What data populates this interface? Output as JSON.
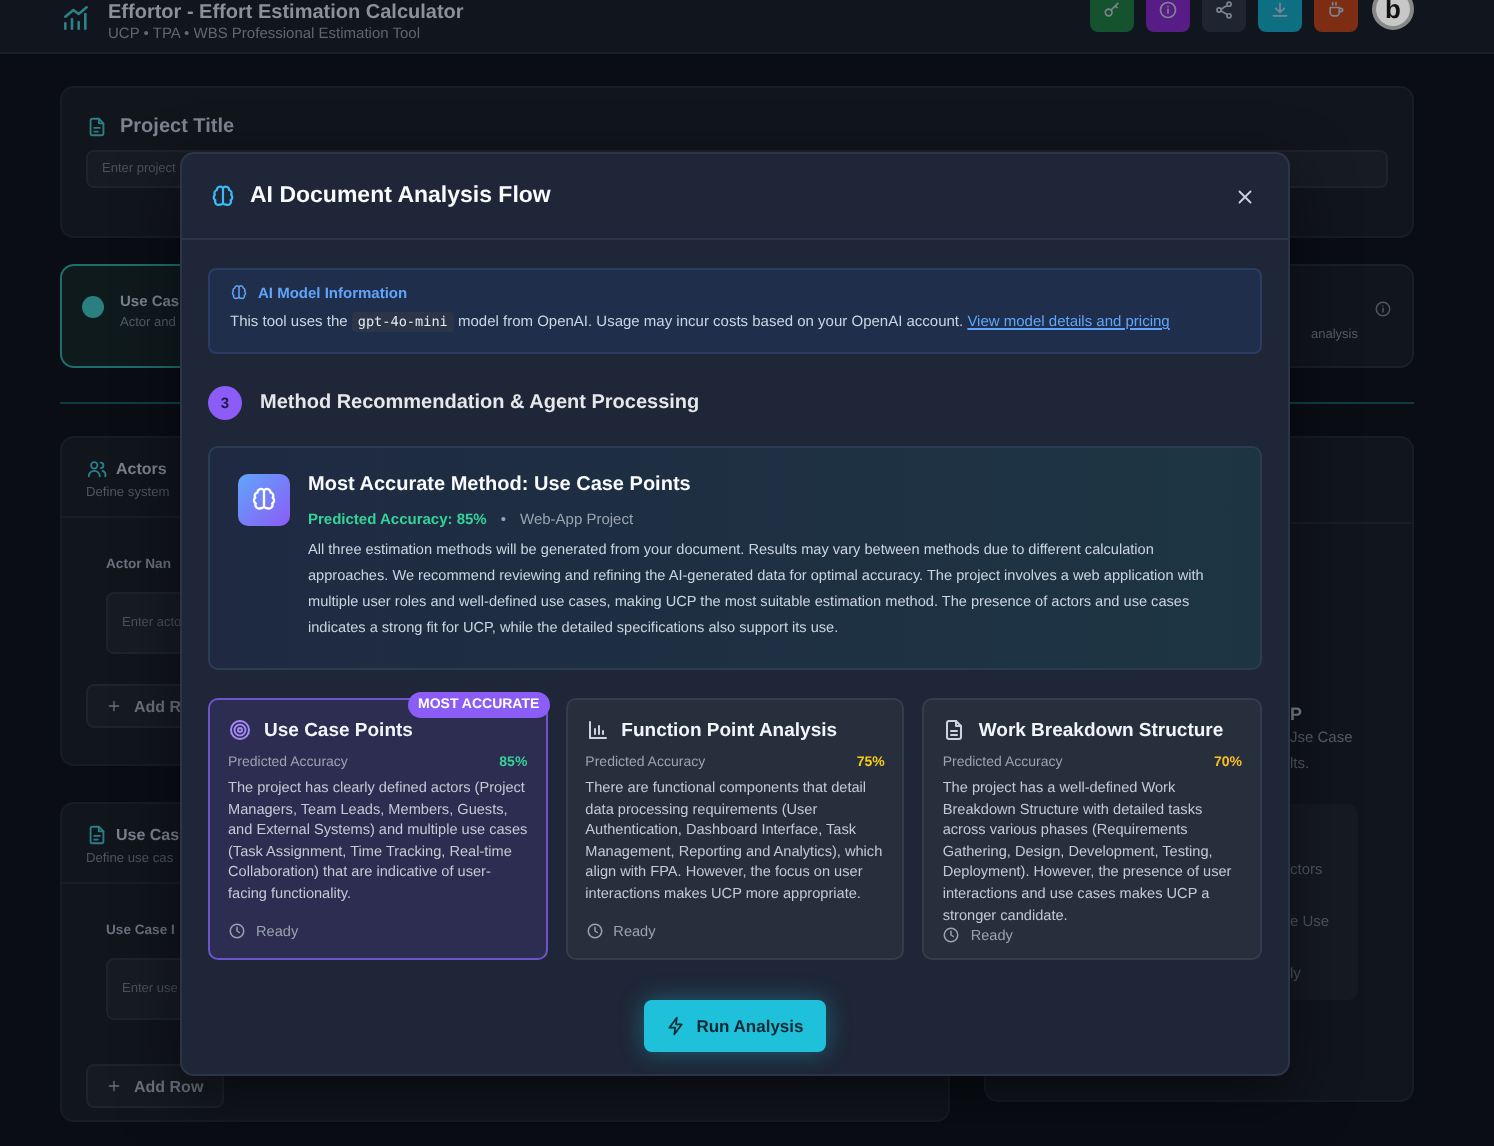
{
  "header": {
    "title": "Effortor - Effort Estimation Calculator",
    "subtitle": "UCP • TPA • WBS Professional Estimation Tool",
    "actions": [
      {
        "kind": "key",
        "color": "#14532d"
      },
      {
        "kind": "info",
        "color": "#581c87"
      },
      {
        "kind": "share",
        "color": "#1f2530"
      },
      {
        "kind": "download",
        "color": "#0e6f82"
      },
      {
        "kind": "coffee",
        "color": "#7c2d12"
      }
    ],
    "avatar": "b"
  },
  "project": {
    "title": "Project Title",
    "placeholder": "Enter project"
  },
  "options": [
    {
      "title": "Use Cas",
      "description": "Actor and",
      "selected": true
    },
    {
      "description": "analysis",
      "selected": false
    }
  ],
  "actors": {
    "title": "Actors",
    "description": "Define system",
    "column": "Actor Nan",
    "placeholder": "Enter acto",
    "add": "Add R"
  },
  "use_cases": {
    "title": "Use Cas",
    "description": "Define use cas",
    "column": "Use Case I",
    "placeholder": "Enter use",
    "add": "Add Row"
  },
  "results": {
    "title": "P",
    "lines": [
      "Jse Case",
      "lts."
    ],
    "notes": [
      "ctors",
      "e Use",
      "ly"
    ]
  },
  "modal": {
    "title": "AI Document Analysis Flow",
    "info": {
      "title": "AI Model Information",
      "text_before": "This tool uses the",
      "code": "gpt-4o-mini",
      "text_after": "model from OpenAI. Usage may incur costs based on your OpenAI account.",
      "link": "View model details and pricing"
    },
    "step": {
      "number": "3",
      "title": "Method Recommendation & Agent Processing"
    },
    "recommendation": {
      "title": "Most Accurate Method: Use Case Points",
      "accuracy": "Predicted Accuracy: 85%",
      "separator": "•",
      "project_type": "Web-App Project",
      "text": "All three estimation methods will be generated from your document. Results may vary between methods due to different calculation approaches. We recommend reviewing and refining the AI-generated data for optimal accuracy. The project involves a web application with multiple user roles and well-defined use cases, making UCP the most suitable estimation method. The presence of actors and use cases indicates a strong fit for UCP, while the detailed specifications also support its use."
    },
    "methods": [
      {
        "kind": "target",
        "title": "Use Case Points",
        "label": "Predicted Accuracy",
        "accuracy": "85%",
        "color": "#34d399",
        "description": "The project has clearly defined actors (Project Managers, Team Leads, Members, Guests, and External Systems) and multiple use cases (Task Assignment, Time Tracking, Real-time Collaboration) that are indicative of user-facing functionality.",
        "status": "Ready",
        "selected": true,
        "badge": "MOST ACCURATE"
      },
      {
        "kind": "chart",
        "title": "Function Point Analysis",
        "label": "Predicted Accuracy",
        "accuracy": "75%",
        "color": "#facc15",
        "description": "There are functional components that detail data processing requirements (User Authentication, Dashboard Interface, Task Management, Reporting and Analytics), which align with FPA. However, the focus on user interactions makes UCP more appropriate.",
        "status": "Ready",
        "selected": false
      },
      {
        "kind": "document",
        "title": "Work Breakdown Structure",
        "label": "Predicted Accuracy",
        "accuracy": "70%",
        "color": "#fbbf24",
        "description": "The project has a well-defined Work Breakdown Structure with detailed tasks across various phases (Requirements Gathering, Design, Development, Testing, Deployment). However, the presence of user interactions and use cases makes UCP a stronger candidate.",
        "status": "Ready",
        "selected": false
      }
    ],
    "run_button": "Run Analysis"
  }
}
